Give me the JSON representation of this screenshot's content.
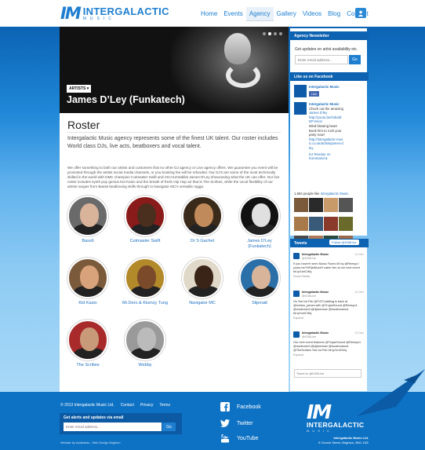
{
  "brand": {
    "mark": "IM",
    "name": "INTERGALACTIC",
    "sub": "MUSIC",
    "primary_color": "#1e7fd0"
  },
  "nav": {
    "items": [
      "Home",
      "Events",
      "Agency",
      "Gallery",
      "Videos",
      "Blog",
      "Contact"
    ],
    "active": "Agency",
    "user_icon": "user-icon"
  },
  "hero": {
    "tag": "ARTISTS ▾",
    "title": "James D’Ley (Funkatech)",
    "slides": 4,
    "active_slide": 1
  },
  "roster": {
    "title": "Roster",
    "intro": "Intergalactic Music agency represents some of the finest UK talent. Our roster includes World class DJs, live acts, beatboxers and vocal talent.",
    "body": "We offer something to both our artists and customers that no other DJ agency or Live agency offers. We guarantee you event will be promoted through the artists social media channels, or you booking fee will be refunded. Our DJ's are some of the most technically skilled in the world with DMC champion Cutmaster Swift and CDJ turntablist James D'Ley showcasing what the UK can offer. Our live roster includes synth pop genius Kid Kasio and the breath of fresh Hip Hop air that is The Scribes, while the vocal flexibility of our artists ranges from Bass6 beatboxing skills through to Navigator MC's versatile ragga.",
    "artists": [
      {
        "name": "Bass6",
        "bg": "#6a6a6a",
        "skin": "#d9b49a"
      },
      {
        "name": "Cutmaster Swift",
        "bg": "#8a1b1b",
        "skin": "#4a2e1e"
      },
      {
        "name": "Dr S Gachet",
        "bg": "#3a2a1a",
        "skin": "#c08a5a"
      },
      {
        "name": "James D'Ley (Funkatech)",
        "bg": "#111111",
        "skin": "#e0e0e0"
      },
      {
        "name": "Kid Kasio",
        "bg": "#7a5a3a",
        "skin": "#d8a27a"
      },
      {
        "name": "Mr.Dero & Klumzy Tung",
        "bg": "#b38a2a",
        "skin": "#7a4a2a"
      },
      {
        "name": "Navigator MC",
        "bg": "#e0d8c8",
        "skin": "#3a2418"
      },
      {
        "name": "Slipmatt",
        "bg": "#2a6fa8",
        "skin": "#d8b49a"
      },
      {
        "name": "The Scribes",
        "bg": "#a82a2a",
        "skin": "#c89a7a"
      },
      {
        "name": "Webby",
        "bg": "#9a9a9a",
        "skin": "#bbbbbb"
      }
    ]
  },
  "sidebar": {
    "newsletter": {
      "heading": "Agency Newsletter",
      "text": "Get updates on artist availability etc.",
      "placeholder": "Enter email address...",
      "button": "Go"
    },
    "facebook": {
      "heading": "Like us on Facebook",
      "page_name": "Intergalactic Music",
      "like_button": "Like",
      "post_author": "Intergalactic Music",
      "post_text_1": "Check out the amazing",
      "post_link_1": "James D'ley",
      "post_link_2": "http://youtu.be/OduddEP-0scU",
      "post_text_2": "Mind blowing beat! Book him to rock your party now!",
      "post_link_3": "http://intergalactic-music.co.uk/artists/james-dley",
      "footer_link": "DJ Reedoe on Kommand &",
      "fans_text": "1,684 people like",
      "fans_link": "Intergalactic Music.",
      "fan_colors": [
        "#7a5a3a",
        "#2a2a2a",
        "#c89a6a",
        "#555555",
        "#a87a4a",
        "#3a5a7a",
        "#8a3a2a",
        "#6a6a2a",
        "#4a4a4a",
        "#b07a5a",
        "#2a4a3a",
        "#9a6a4a"
      ]
    },
    "twitter": {
      "heading": "Tweets",
      "follow_button": "Follow @IGMLive",
      "tweets": [
        {
          "name": "Intergalactic Music",
          "handle": "@IGMLive",
          "when": "11 Dec",
          "text": "If you haven't seen Music Faces #5 by @Reesyo ! youtu.be/YhRjsWuzoH catch him at our next event bit.ly/1mlCWq",
          "action": "Show Media"
        },
        {
          "name": "Intergalactic Music",
          "handle": "@IGMLive",
          "when": "11 Dec",
          "text": "On Sat 1st Feb @TriTCoddling  is back at @london_james with @TrojanSound @Reesyo1 @modicsexii @djdoemow @localmusicuk bit.ly/1mlCWq",
          "action": "Expand"
        },
        {
          "name": "Intergalactic Music",
          "handle": "@IGMLive",
          "when": "11 Dec",
          "text": "Our next event features @TrojanSound @Reesyo1 @modicsexii @djdoemow @localmusicuk @TheScribes Sat 1st Feb bit.ly/1mlCWq",
          "action": "Expand"
        }
      ],
      "compose_placeholder": "Tweet to @IGMLive"
    }
  },
  "footer": {
    "copyright": "© 2013 Intergalactic Music Ltd.",
    "links": [
      "Contact",
      "Privacy",
      "Terms"
    ],
    "signup_label": "Get alerts and updates via email",
    "signup_placeholder": "Enter email address...",
    "signup_button": "Go",
    "credit": "Website by studiotedo - Web Design Brighton",
    "social": [
      {
        "label": "Facebook",
        "icon": "facebook-icon"
      },
      {
        "label": "Twitter",
        "icon": "twitter-icon"
      },
      {
        "label": "YouTube",
        "icon": "youtube-icon"
      }
    ],
    "address_line1": "Intergalactic Music Ltd.",
    "address_line2": "9 Church Street, Brighton, BN1 1UE"
  }
}
